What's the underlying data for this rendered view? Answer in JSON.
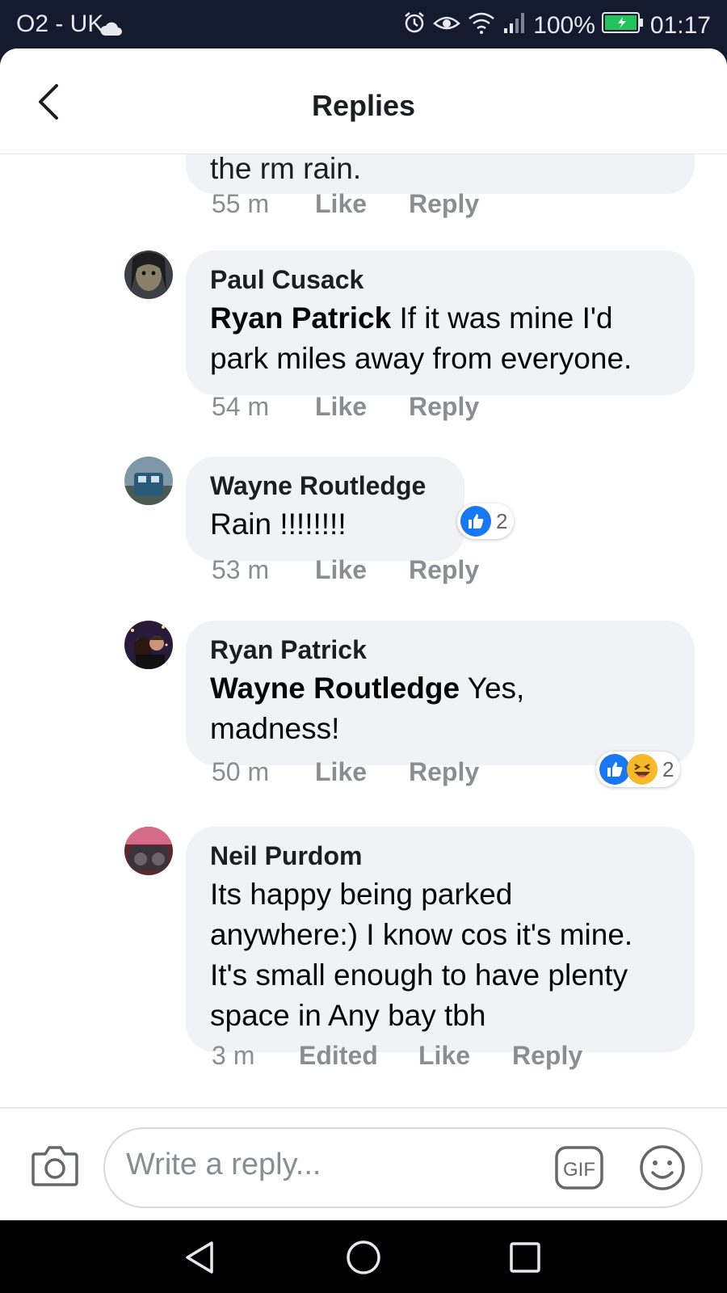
{
  "status_bar": {
    "carrier": "O2 - UK",
    "battery": "100%",
    "time": "01:17"
  },
  "header": {
    "title": "Replies"
  },
  "top_comment": {
    "partial_text": "the rm rain.",
    "time": "55 m",
    "like": "Like",
    "reply": "Reply"
  },
  "comments": [
    {
      "author": "Paul Cusack",
      "mention": "Ryan Patrick",
      "text": " If it was  mine I'd park miles away from everyone.",
      "time": "54 m",
      "like": "Like",
      "reply": "Reply"
    },
    {
      "author": "Wayne Routledge",
      "mention": "",
      "text": "Rain !!!!!!!!",
      "time": "53 m",
      "like": "Like",
      "reply": "Reply",
      "reaction_count": "2",
      "reactions": [
        "like-icon"
      ]
    },
    {
      "author": "Ryan Patrick",
      "mention": "Wayne Routledge",
      "text": " Yes, madness!",
      "time": "50 m",
      "like": "Like",
      "reply": "Reply",
      "reaction_count": "2",
      "reactions": [
        "like-icon",
        "haha-icon"
      ]
    },
    {
      "author": "Neil Purdom",
      "mention": "",
      "text": "Its happy being parked anywhere:) I know cos it's mine. It's small enough to have plenty space in Any bay tbh",
      "time": "3 m",
      "edited": "Edited",
      "like": "Like",
      "reply": "Reply"
    }
  ],
  "composer": {
    "placeholder": "Write a reply...",
    "gif_label": "GIF"
  },
  "colors": {
    "accent": "#1877f2",
    "bubble": "#f0f2f5",
    "muted": "#8a8d91",
    "status_bar": "#151b2e",
    "haha": "#f7b928"
  }
}
